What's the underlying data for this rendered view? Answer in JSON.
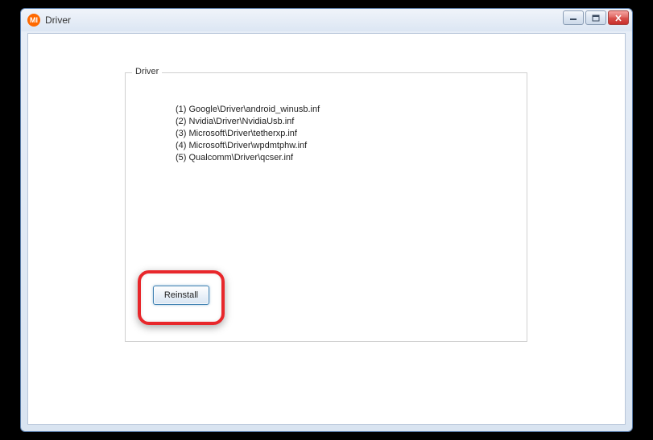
{
  "window": {
    "title": "Driver",
    "icon_label": "MI"
  },
  "groupbox": {
    "label": "Driver"
  },
  "drivers": [
    "(1) Google\\Driver\\android_winusb.inf",
    "(2) Nvidia\\Driver\\NvidiaUsb.inf",
    "(3) Microsoft\\Driver\\tetherxp.inf",
    "(4) Microsoft\\Driver\\wpdmtphw.inf",
    "(5) Qualcomm\\Driver\\qcser.inf"
  ],
  "buttons": {
    "reinstall": "Reinstall"
  },
  "colors": {
    "highlight": "#e8272b",
    "window_border": "#5a7ca8",
    "button_border": "#3c7fb1"
  }
}
